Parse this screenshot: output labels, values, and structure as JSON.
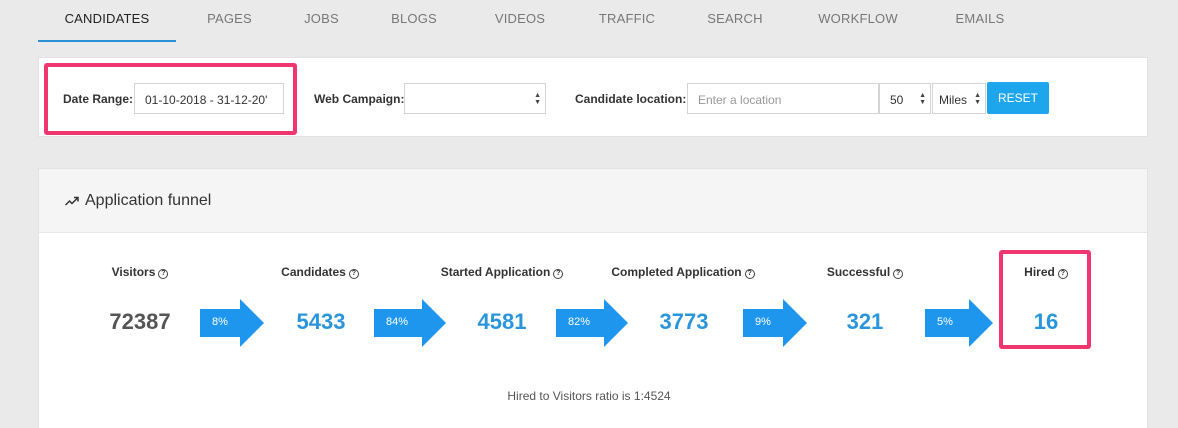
{
  "tabs": [
    {
      "label": "CANDIDATES",
      "active": true
    },
    {
      "label": "PAGES"
    },
    {
      "label": "JOBS"
    },
    {
      "label": "BLOGS"
    },
    {
      "label": "VIDEOS"
    },
    {
      "label": "TRAFFIC"
    },
    {
      "label": "SEARCH"
    },
    {
      "label": "WORKFLOW"
    },
    {
      "label": "EMAILS"
    }
  ],
  "filters": {
    "date_range_label": "Date Range:",
    "date_range_value": "01-10-2018 - 31-12-20'",
    "web_campaign_label": "Web Campaign:",
    "web_campaign_value": "",
    "candidate_location_label": "Candidate location:",
    "location_placeholder": "Enter a location",
    "radius_value": "50",
    "unit_value": "Miles",
    "reset_label": "RESET"
  },
  "funnel": {
    "title": "Application funnel",
    "stages": [
      {
        "label": "Visitors",
        "value": "72387"
      },
      {
        "label": "Candidates",
        "value": "5433"
      },
      {
        "label": "Started Application",
        "value": "4581"
      },
      {
        "label": "Completed Application",
        "value": "3773"
      },
      {
        "label": "Successful",
        "value": "321"
      },
      {
        "label": "Hired",
        "value": "16"
      }
    ],
    "conversions": [
      "8%",
      "84%",
      "82%",
      "9%",
      "5%"
    ],
    "ratio_text": "Hired to Visitors ratio is",
    "ratio_value": "1:4524"
  },
  "colors": {
    "accent": "#1ea6ec",
    "value_blue": "#2b95dc",
    "arrow_blue": "#1e96ee",
    "highlight": "#f0366f"
  }
}
